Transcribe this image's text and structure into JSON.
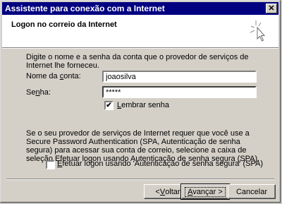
{
  "window": {
    "title": "Assistente para conexão com a Internet",
    "close_glyph": "✕"
  },
  "header": {
    "title": "Logon no correio da Internet"
  },
  "intro": "Digite o nome e a senha da conta que o provedor de serviços de Internet lhe forneceu.",
  "account": {
    "label_pre": "Nome da ",
    "label_key": "c",
    "label_post": "onta:",
    "value": "joaosilva"
  },
  "password": {
    "label_pre": "Se",
    "label_key": "n",
    "label_post": "ha:",
    "value": "*****"
  },
  "remember": {
    "checked": true,
    "check_glyph": "✔",
    "label_key": "L",
    "label_post": "embrar senha"
  },
  "spa_text": "Se o seu provedor de serviços de Internet requer que você use a Secure Password Authentication (SPA, Autenticação de senha segura) para acessar sua conta de correio, selecione a caixa de seleção Efetuar logon usando Autenticação de senha segura (SPA).",
  "spa_checkbox": {
    "checked": false,
    "label_key": "E",
    "label_post": "fetuar logon usando 'Autenticação de senha segura' (SPA)"
  },
  "buttons": {
    "back": {
      "prefix": "< ",
      "key": "V",
      "rest": "oltar"
    },
    "next": {
      "key": "A",
      "rest": "vançar >"
    },
    "cancel": {
      "label": "Cancelar"
    }
  },
  "colors": {
    "titlebar": "#000080",
    "face": "#d4d0c8",
    "header_bg": "#ffffff"
  }
}
